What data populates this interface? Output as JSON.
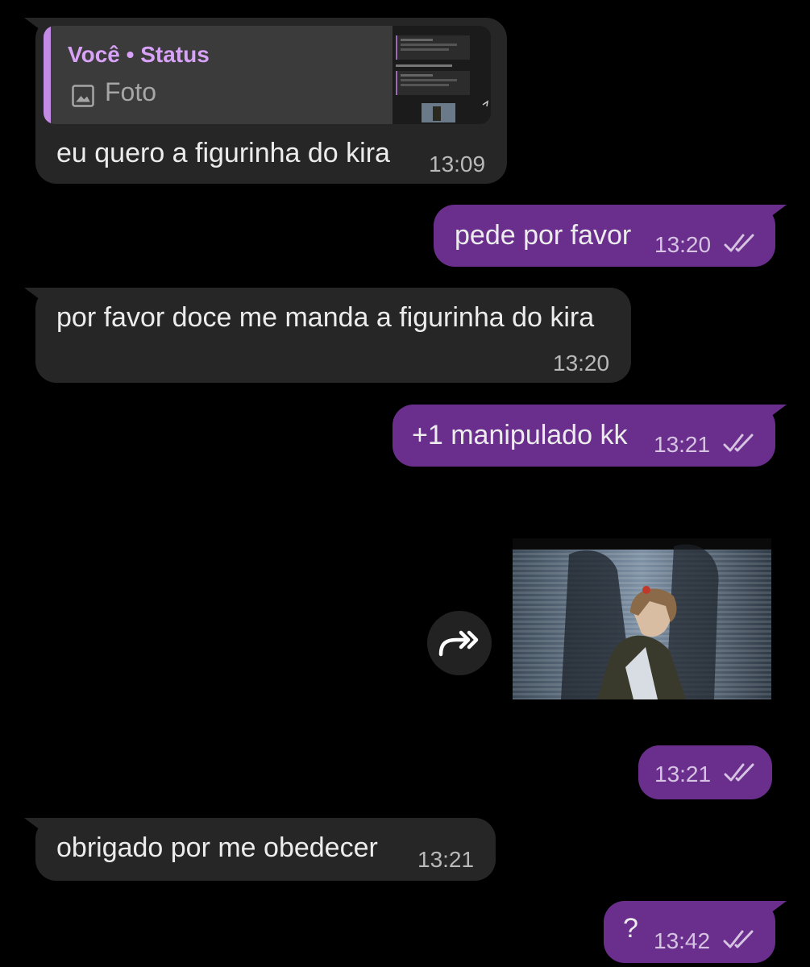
{
  "colors": {
    "background": "#000000",
    "incoming_bubble": "#262626",
    "outgoing_bubble": "#6a2f8c",
    "quote_accent": "#c38ae6",
    "quote_author": "#d7a2f7"
  },
  "messages": [
    {
      "direction": "incoming",
      "quote": {
        "author": "Você • Status",
        "label": "Foto",
        "icon": "image-icon"
      },
      "text": "eu quero a figurinha do kira",
      "time": "13:09"
    },
    {
      "direction": "outgoing",
      "text": "pede por favor",
      "time": "13:20",
      "status": "read-double-check"
    },
    {
      "direction": "incoming",
      "text": "por favor doce me manda a figurinha do kira",
      "time": "13:20"
    },
    {
      "direction": "outgoing",
      "text": "+1 manipulado kk",
      "time": "13:21",
      "status": "read-double-check"
    },
    {
      "direction": "outgoing",
      "type": "sticker",
      "sticker": "anime character leaning against shutter",
      "forward_icon": "forward-icon"
    },
    {
      "direction": "outgoing",
      "text": "",
      "time": "13:21",
      "status": "read-double-check"
    },
    {
      "direction": "incoming",
      "text": "obrigado por me obedecer",
      "time": "13:21"
    },
    {
      "direction": "outgoing",
      "text": "?",
      "time": "13:42",
      "status": "read-double-check"
    }
  ]
}
